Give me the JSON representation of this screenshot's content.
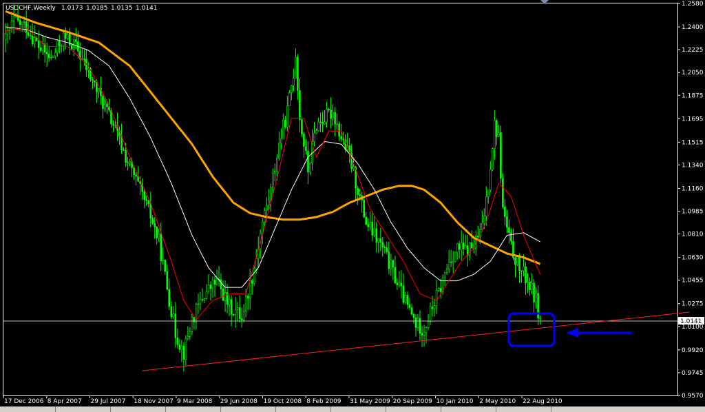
{
  "chart_data": {
    "type": "candlestick",
    "symbol": "USDCHF,Weekly",
    "ohlc_header": [
      "1.0173",
      "1.0185",
      "1.0135",
      "1.0141"
    ],
    "y_ticks": [
      "1.2580",
      "1.2400",
      "1.2225",
      "1.2050",
      "1.1875",
      "1.1695",
      "1.1515",
      "1.1340",
      "1.1160",
      "1.0985",
      "1.0810",
      "1.0630",
      "1.0455",
      "1.0275",
      "1.0100",
      "0.9920",
      "0.9745",
      "0.9570"
    ],
    "ylim": [
      0.957,
      1.258
    ],
    "x_tick_labels": [
      "17 Dec 2006",
      "8 Apr 2007",
      "29 Jul 2007",
      "18 Nov 2007",
      "9 Mar 2008",
      "29 Jun 2008",
      "19 Oct 2008",
      "8 Feb 2009",
      "31 May 2009",
      "20 Sep 2009",
      "10 Jan 2010",
      "2 May 2010",
      "22 Aug 2010"
    ],
    "current_price": "1.0141",
    "price_anchors": [
      [
        0,
        1.23
      ],
      [
        4,
        1.245
      ],
      [
        10,
        1.24
      ],
      [
        16,
        1.225
      ],
      [
        22,
        1.215
      ],
      [
        28,
        1.232
      ],
      [
        34,
        1.225
      ],
      [
        40,
        1.205
      ],
      [
        46,
        1.185
      ],
      [
        52,
        1.165
      ],
      [
        58,
        1.14
      ],
      [
        64,
        1.118
      ],
      [
        70,
        1.095
      ],
      [
        74,
        1.075
      ],
      [
        78,
        1.04
      ],
      [
        82,
        1.005
      ],
      [
        86,
        0.99
      ],
      [
        90,
        1.015
      ],
      [
        96,
        1.035
      ],
      [
        102,
        1.045
      ],
      [
        108,
        1.025
      ],
      [
        114,
        1.018
      ],
      [
        120,
        1.055
      ],
      [
        124,
        1.09
      ],
      [
        128,
        1.115
      ],
      [
        132,
        1.15
      ],
      [
        136,
        1.175
      ],
      [
        139,
        1.205
      ],
      [
        140,
        1.22
      ],
      [
        142,
        1.17
      ],
      [
        146,
        1.13
      ],
      [
        150,
        1.165
      ],
      [
        154,
        1.17
      ],
      [
        158,
        1.175
      ],
      [
        162,
        1.155
      ],
      [
        166,
        1.14
      ],
      [
        170,
        1.115
      ],
      [
        174,
        1.09
      ],
      [
        178,
        1.08
      ],
      [
        182,
        1.07
      ],
      [
        186,
        1.055
      ],
      [
        190,
        1.04
      ],
      [
        194,
        1.025
      ],
      [
        198,
        1.012
      ],
      [
        202,
        1.008
      ],
      [
        206,
        1.025
      ],
      [
        210,
        1.04
      ],
      [
        214,
        1.06
      ],
      [
        218,
        1.07
      ],
      [
        222,
        1.068
      ],
      [
        226,
        1.072
      ],
      [
        230,
        1.085
      ],
      [
        233,
        1.12
      ],
      [
        236,
        1.165
      ],
      [
        238,
        1.155
      ],
      [
        240,
        1.1
      ],
      [
        244,
        1.07
      ],
      [
        248,
        1.055
      ],
      [
        252,
        1.045
      ],
      [
        256,
        1.03
      ],
      [
        258,
        1.014
      ]
    ],
    "ma_fast_anchors": [
      [
        0,
        1.237
      ],
      [
        10,
        1.239
      ],
      [
        20,
        1.225
      ],
      [
        30,
        1.225
      ],
      [
        40,
        1.21
      ],
      [
        50,
        1.18
      ],
      [
        60,
        1.14
      ],
      [
        70,
        1.105
      ],
      [
        80,
        1.06
      ],
      [
        86,
        1.03
      ],
      [
        92,
        1.015
      ],
      [
        100,
        1.03
      ],
      [
        108,
        1.035
      ],
      [
        116,
        1.035
      ],
      [
        124,
        1.08
      ],
      [
        132,
        1.13
      ],
      [
        138,
        1.17
      ],
      [
        144,
        1.17
      ],
      [
        150,
        1.14
      ],
      [
        156,
        1.16
      ],
      [
        162,
        1.16
      ],
      [
        168,
        1.135
      ],
      [
        176,
        1.1
      ],
      [
        184,
        1.08
      ],
      [
        192,
        1.06
      ],
      [
        200,
        1.035
      ],
      [
        208,
        1.03
      ],
      [
        214,
        1.045
      ],
      [
        220,
        1.06
      ],
      [
        226,
        1.07
      ],
      [
        232,
        1.09
      ],
      [
        238,
        1.12
      ],
      [
        244,
        1.11
      ],
      [
        250,
        1.08
      ],
      [
        258,
        1.05
      ]
    ],
    "ma_mid_anchors": [
      [
        0,
        1.24
      ],
      [
        10,
        1.238
      ],
      [
        20,
        1.232
      ],
      [
        30,
        1.228
      ],
      [
        40,
        1.222
      ],
      [
        50,
        1.21
      ],
      [
        60,
        1.185
      ],
      [
        70,
        1.155
      ],
      [
        80,
        1.12
      ],
      [
        90,
        1.08
      ],
      [
        98,
        1.055
      ],
      [
        106,
        1.04
      ],
      [
        114,
        1.04
      ],
      [
        122,
        1.055
      ],
      [
        130,
        1.085
      ],
      [
        138,
        1.115
      ],
      [
        146,
        1.14
      ],
      [
        154,
        1.152
      ],
      [
        162,
        1.15
      ],
      [
        170,
        1.135
      ],
      [
        178,
        1.115
      ],
      [
        186,
        1.09
      ],
      [
        194,
        1.07
      ],
      [
        202,
        1.055
      ],
      [
        210,
        1.045
      ],
      [
        218,
        1.045
      ],
      [
        226,
        1.05
      ],
      [
        234,
        1.06
      ],
      [
        242,
        1.08
      ],
      [
        250,
        1.082
      ],
      [
        258,
        1.075
      ]
    ],
    "ma_slow_anchors": [
      [
        0,
        1.252
      ],
      [
        15,
        1.243
      ],
      [
        30,
        1.236
      ],
      [
        45,
        1.228
      ],
      [
        60,
        1.21
      ],
      [
        75,
        1.18
      ],
      [
        90,
        1.15
      ],
      [
        100,
        1.125
      ],
      [
        110,
        1.105
      ],
      [
        118,
        1.097
      ],
      [
        126,
        1.094
      ],
      [
        134,
        1.092
      ],
      [
        142,
        1.092
      ],
      [
        150,
        1.094
      ],
      [
        158,
        1.098
      ],
      [
        166,
        1.105
      ],
      [
        174,
        1.11
      ],
      [
        182,
        1.115
      ],
      [
        190,
        1.118
      ],
      [
        196,
        1.118
      ],
      [
        202,
        1.115
      ],
      [
        210,
        1.105
      ],
      [
        218,
        1.09
      ],
      [
        226,
        1.078
      ],
      [
        234,
        1.072
      ],
      [
        242,
        1.066
      ],
      [
        250,
        1.063
      ],
      [
        258,
        1.058
      ]
    ],
    "trendline": {
      "from": [
        66,
        0.976
      ],
      "to": [
        330,
        1.021
      ]
    },
    "colors": {
      "candles": "#00ff00",
      "ma_fast": "#ff0000",
      "ma_mid": "#ffffff",
      "ma_slow": "#ffa500",
      "trendline": "#ff2020",
      "highlight_box": "#0000ff",
      "arrow": "#0000ff",
      "price_line": "#c0c0c0"
    }
  }
}
